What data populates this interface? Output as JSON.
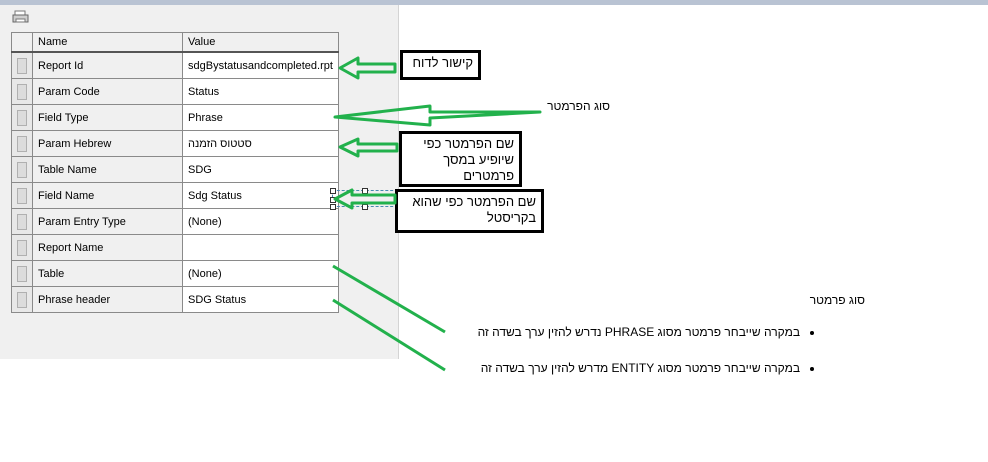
{
  "grid": {
    "headers": [
      "Name",
      "Value"
    ],
    "rows": [
      {
        "name": "Report Id",
        "value": "sdgBystatusandcompleted.rpt"
      },
      {
        "name": "Param Code",
        "value": "Status"
      },
      {
        "name": "Field Type",
        "value": "Phrase"
      },
      {
        "name": "Param Hebrew",
        "value": "סטטוס הזמנה"
      },
      {
        "name": "Table Name",
        "value": "SDG"
      },
      {
        "name": "Field Name",
        "value": "Sdg Status"
      },
      {
        "name": "Param Entry Type",
        "value": "(None)"
      },
      {
        "name": "Report Name",
        "value": ""
      },
      {
        "name": "Table",
        "value": "(None)"
      },
      {
        "name": "Phrase header",
        "value": "SDG Status"
      }
    ]
  },
  "annotations": {
    "report_link": "קישור לדוח",
    "param_type": "סוג הפרמטר",
    "param_screen_name": "שם הפרמטר כפי שיופיע במסך פרמטרים",
    "param_crystal_name": "שם הפרמטר כפי שהוא בקריסטל",
    "param_type_heading": "סוג פרמטר",
    "bullets": [
      "במקרה שייבחר פרמטר מסוג PHRASE נדרש להזין ערך בשדה זה",
      "במקרה שייבחר פרמטר מסוג ENTITY מדרש להזין ערך בשדה זה"
    ]
  },
  "colors": {
    "arrow": "#22b14c",
    "panel": "#f0f0f0",
    "topband": "#b9c3d3"
  }
}
